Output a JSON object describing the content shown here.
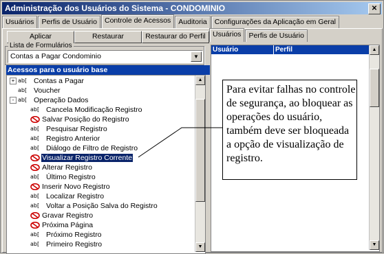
{
  "window": {
    "title": "Administração dos Usuários do Sistema - CONDOMINIO",
    "close_glyph": "✕"
  },
  "main_tabs": [
    "Usuários",
    "Perfis de Usuário",
    "Controle de Acessos",
    "Auditoria",
    "Configurações da Aplicação em Geral"
  ],
  "toolbar": {
    "apply": "Aplicar",
    "restore": "Restaurar",
    "restore_profile": "Restaurar do Perfil"
  },
  "forms": {
    "group_label": "Lista de Formulários",
    "selected": "Contas a Pagar Condominio"
  },
  "tree": {
    "header": "Acessos para o usuário base",
    "roots": [
      {
        "label": "Contas a Pagar",
        "expander": "+"
      },
      {
        "label": "Voucher",
        "expander": ""
      },
      {
        "label": "Operação Dados",
        "expander": "-"
      }
    ],
    "items": [
      {
        "label": "Cancela Modificação Registro",
        "denied": false
      },
      {
        "label": "Salvar Posição do Registro",
        "denied": true
      },
      {
        "label": "Pesquisar Registro",
        "denied": false
      },
      {
        "label": "Registro Anterior",
        "denied": false
      },
      {
        "label": "Diálogo de Filtro de Registro",
        "denied": false
      },
      {
        "label": "Visualizar Registro Corrente",
        "denied": true,
        "selected": true
      },
      {
        "label": "Alterar Registro",
        "denied": true
      },
      {
        "label": "Último Registro",
        "denied": false
      },
      {
        "label": "Inserir Novo Registro",
        "denied": true
      },
      {
        "label": "Localizar Registro",
        "denied": false
      },
      {
        "label": "Voltar a Posição Salva do Registro",
        "denied": false
      },
      {
        "label": "Gravar Registro",
        "denied": true
      },
      {
        "label": "Próxima Página",
        "denied": true
      },
      {
        "label": "Próximo Registro",
        "denied": false
      },
      {
        "label": "Primeiro Registro",
        "denied": false
      }
    ],
    "ab_glyph": "ab["
  },
  "right_tabs": [
    "Usuários",
    "Perfis de Usuário"
  ],
  "grid": {
    "col_user": "Usuário",
    "col_profile": "Perfil"
  },
  "callout": {
    "text": "Para evitar falhas no controle de segurança, ao bloquear as operações do usuário, também deve ser bloqueada a opção de visualização de registro."
  },
  "colors": {
    "title_start": "#0a246a",
    "header_blue": "#0a3ea8",
    "denied_red": "#cc0000"
  }
}
